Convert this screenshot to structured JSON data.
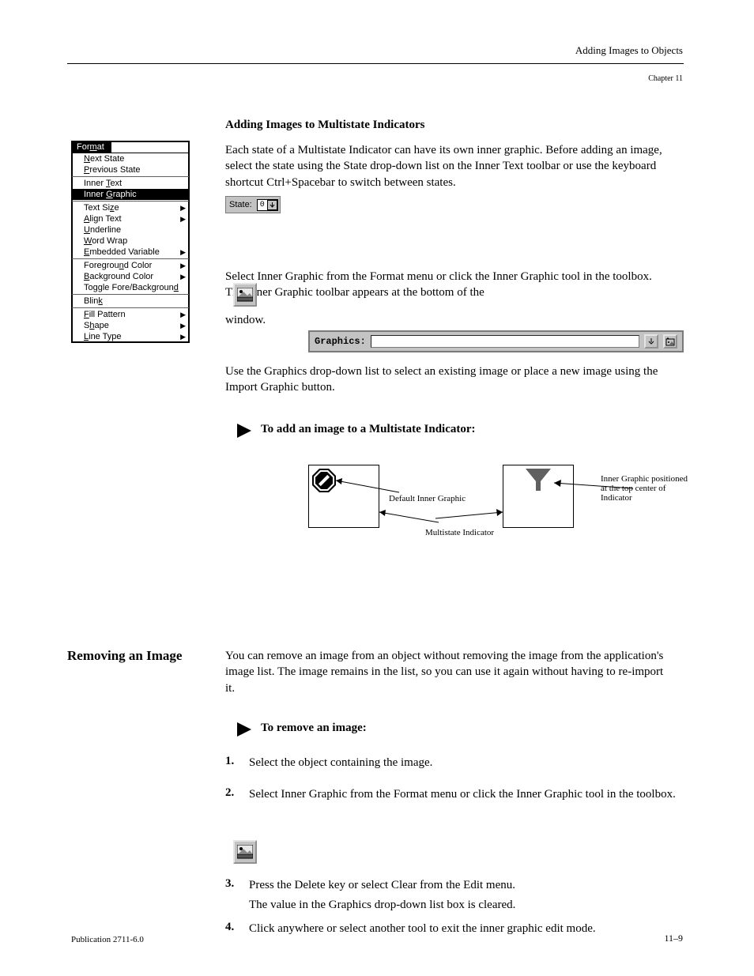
{
  "running_head": "Adding Images to Objects",
  "chapter_label": "Chapter  11",
  "section1_title": "Adding Images to Multistate Indicators",
  "menu": {
    "title_prefix": "For",
    "title_u": "m",
    "title_suffix": "at",
    "items": [
      {
        "pre": "",
        "u": "N",
        "post": "ext State",
        "sub": false
      },
      {
        "pre": "",
        "u": "P",
        "post": "revious State",
        "sub": false
      },
      {
        "pre": "Inner ",
        "u": "T",
        "post": "ext",
        "sub": false
      },
      {
        "pre": "Inner ",
        "u": "G",
        "post": "raphic",
        "sub": false,
        "highlight": true
      },
      {
        "pre": "Text Si",
        "u": "z",
        "post": "e",
        "sub": true
      },
      {
        "pre": "",
        "u": "A",
        "post": "lign Text",
        "sub": true
      },
      {
        "pre": "",
        "u": "U",
        "post": "nderline",
        "sub": false
      },
      {
        "pre": "",
        "u": "W",
        "post": "ord Wrap",
        "sub": false
      },
      {
        "pre": "",
        "u": "E",
        "post": "mbedded Variable",
        "sub": true
      },
      {
        "pre": "Foregrou",
        "u": "n",
        "post": "d Color",
        "sub": true
      },
      {
        "pre": "",
        "u": "B",
        "post": "ackground Color",
        "sub": true
      },
      {
        "pre": "Toggle Fore/Backgroun",
        "u": "d",
        "post": "",
        "sub": false
      },
      {
        "pre": "Blin",
        "u": "k",
        "post": "",
        "sub": false
      },
      {
        "pre": "",
        "u": "F",
        "post": "ill Pattern",
        "sub": true
      },
      {
        "pre": "S",
        "u": "h",
        "post": "ape",
        "sub": true
      },
      {
        "pre": "",
        "u": "L",
        "post": "ine Type",
        "sub": true
      }
    ]
  },
  "state": {
    "label": "State:",
    "value": "0"
  },
  "para1": "Each state of a Multistate Indicator can have its own inner graphic. Before adding an image, select the state using the State drop-down list on the Inner Text toolbar or use the keyboard shortcut Ctrl+Spacebar to switch between states.",
  "para2_a": "Select Inner Graphic from the Format menu or click the Inner Graphic tool      in the toolbox. The Inner Graphic toolbar appears at the bottom of the",
  "para2_b": "window.",
  "graphics_label": "Graphics:",
  "proc_note": "Use the Graphics drop-down list to select an existing image or place a new image using the Import Graphic button.",
  "proc1_heading": "To add an image to a Multistate Indicator:",
  "settings_label1": "Default Inner Graphic",
  "settings_label2": "Multistate Indicator",
  "settings_label3": "Inner Graphic positioned",
  "settings_label4": "at the top center of Indicator",
  "removing_heading": "Removing an Image",
  "removing_para": "You can remove an image from an object without removing the image from the application's image list. The image remains in the list, so you can use it again without having to re-import it.",
  "proc2_heading": "To remove an image:",
  "step1_text": "Select the object containing the image.",
  "step2_a": "Select Inner Graphic from the Format menu or click the Inner Graphic tool      in the toolbox.",
  "step2_b": "",
  "step3_text": "Press the Delete key or select Clear from the Edit menu.",
  "step3_extra": "The value in the Graphics drop-down list box is cleared.",
  "step4_text": "Click anywhere or select another tool to exit the inner graphic edit mode.",
  "footer_left": "Publication 2711-6.0",
  "footer_right": "11–9"
}
